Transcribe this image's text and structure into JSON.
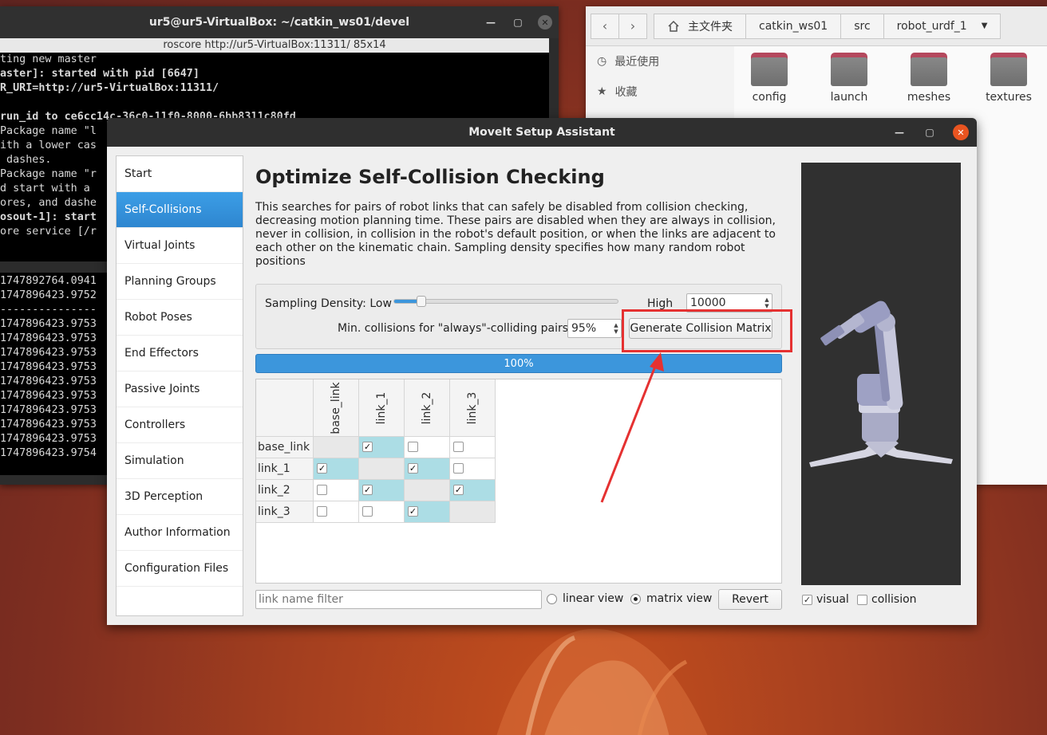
{
  "terminal": {
    "title": "ur5@ur5-VirtualBox: ~/catkin_ws01/devel",
    "tab": "roscore http://ur5-VirtualBox:11311/ 85x14",
    "lines_top": [
      {
        "text": "ting new master",
        "bold": false
      },
      {
        "text": "aster]: started with pid [6647]",
        "bold": true
      },
      {
        "text": "R_URI=http://ur5-VirtualBox:11311/",
        "bold": true
      },
      {
        "text": "",
        "bold": false
      },
      {
        "text": "run_id to ce6cc14c-36c0-11f0-8000-6bb8311c80fd",
        "bold": true
      },
      {
        "text": "Package name \"l",
        "bold": false
      },
      {
        "text": "ith a lower cas",
        "bold": false
      },
      {
        "text": " dashes.",
        "bold": false
      },
      {
        "text": "Package name \"r",
        "bold": false
      },
      {
        "text": "d start with a ",
        "bold": false
      },
      {
        "text": "ores, and dashe",
        "bold": false
      },
      {
        "text": "osout-1]: start",
        "bold": true
      },
      {
        "text": "ore service [/r",
        "bold": false
      }
    ],
    "lines_bottom": [
      "1747892764.0941",
      "1747896423.9752",
      "---------------",
      "1747896423.9753",
      "1747896423.9753",
      "1747896423.9753",
      "1747896423.9753",
      "1747896423.9753",
      "1747896423.9753",
      "1747896423.9753",
      "1747896423.9753",
      "1747896423.9753",
      "1747896423.9754"
    ]
  },
  "file_manager": {
    "back_icon": "‹",
    "forward_icon": "›",
    "breadcrumbs": [
      "主文件夹",
      "catkin_ws01",
      "src",
      "robot_urdf_1"
    ],
    "sidebar": [
      {
        "icon": "clock-icon",
        "label": "最近使用"
      },
      {
        "icon": "star-icon",
        "label": "收藏"
      }
    ],
    "files": [
      "config",
      "launch",
      "meshes",
      "textures"
    ]
  },
  "moveit": {
    "title": "MoveIt Setup Assistant",
    "nav": [
      "Start",
      "Self-Collisions",
      "Virtual Joints",
      "Planning Groups",
      "Robot Poses",
      "End Effectors",
      "Passive Joints",
      "Controllers",
      "Simulation",
      "3D Perception",
      "Author Information",
      "Configuration Files"
    ],
    "active_nav": 1,
    "heading": "Optimize Self-Collision Checking",
    "description": "This searches for pairs of robot links that can safely be disabled from collision checking, decreasing motion planning time. These pairs are disabled when they are always in collision, never in collision, in collision in the robot's default position, or when the links are adjacent to each other on the kinematic chain. Sampling density specifies how many random robot positions",
    "sampling_label": "Sampling Density: Low",
    "sampling_high": "High",
    "sampling_level": 0.12,
    "sampling_value": "10000",
    "min_collisions_label": "Min. collisions for \"always\"-colliding pairs:",
    "min_collisions_value": "95%",
    "generate_button": "Generate Collision Matrix",
    "progress_value": 100,
    "progress_text": "100%",
    "links": [
      "base_link",
      "link_1",
      "link_2",
      "link_3"
    ],
    "matrix": [
      [
        null,
        true,
        false,
        false
      ],
      [
        true,
        null,
        true,
        false
      ],
      [
        false,
        true,
        null,
        true
      ],
      [
        false,
        false,
        true,
        null
      ]
    ],
    "highlight": [
      [
        false,
        true,
        false,
        false
      ],
      [
        true,
        false,
        true,
        false
      ],
      [
        false,
        true,
        false,
        true
      ],
      [
        false,
        false,
        true,
        false
      ]
    ],
    "filter_placeholder": "link name filter",
    "linear_view": "linear view",
    "matrix_view": "matrix view",
    "selected_view": "matrix",
    "revert_button": "Revert",
    "visual_label": "visual",
    "visual_checked": true,
    "collision_label": "collision",
    "collision_checked": false
  },
  "colors": {
    "accent": "#3c96dc",
    "highlight_cell": "#acdde5",
    "annotation_red": "#e53131",
    "ubuntu_orange": "#e95420"
  }
}
